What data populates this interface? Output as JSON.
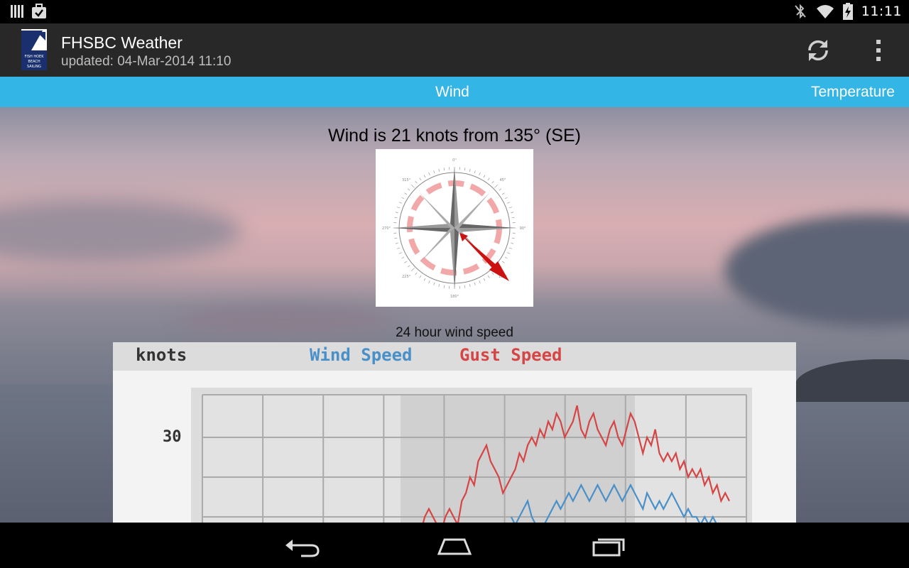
{
  "status_bar": {
    "time": "11:11",
    "left_icons": [
      "signal-bars-icon",
      "briefcase-check-icon"
    ],
    "right_icons": [
      "bluetooth-off-icon",
      "wifi-icon",
      "battery-charging-icon"
    ]
  },
  "action_bar": {
    "title": "FHSBC Weather",
    "subtitle": "updated: 04-Mar-2014 11:10",
    "logo_text": "FISH HOEK BEACH SAILING CLUB",
    "actions": [
      "refresh-icon",
      "overflow-menu-icon"
    ]
  },
  "tabs": [
    {
      "label": "Wind",
      "selected": true
    },
    {
      "label": "Temperature",
      "selected": false
    }
  ],
  "wind": {
    "headline": "Wind is 21 knots from 135° (SE)",
    "direction_deg": 135,
    "speed_knots": 21,
    "compass_labels": [
      "0°",
      "45°",
      "90°",
      "135°",
      "180°",
      "225°",
      "270°",
      "315°"
    ]
  },
  "chart": {
    "caption": "24 hour wind speed",
    "unit_label": "knots",
    "legend": [
      {
        "name": "Wind Speed",
        "color": "#4a90c8"
      },
      {
        "name": "Gust Speed",
        "color": "#d64545"
      }
    ]
  },
  "chart_data": {
    "type": "line",
    "title": "24 hour wind speed",
    "ylabel": "knots",
    "y_ticks_visible": [
      "30"
    ],
    "series": [
      {
        "name": "Wind Speed",
        "values": [
          null,
          null,
          null,
          null,
          null,
          null,
          null,
          null,
          null,
          null,
          null,
          null,
          null,
          null,
          null,
          null,
          null,
          null,
          null,
          null,
          null,
          null,
          null,
          null,
          null,
          null,
          null,
          null,
          null,
          null,
          null,
          null,
          null,
          null,
          null,
          null,
          null,
          null,
          null,
          null,
          null,
          null,
          null,
          null,
          null,
          20,
          19,
          20,
          21,
          22,
          20,
          19,
          18,
          19,
          20,
          21,
          22,
          21,
          22,
          23,
          22,
          23,
          24,
          23,
          22,
          23,
          24,
          23,
          22,
          23,
          24,
          23,
          22,
          23,
          24,
          23,
          22,
          21,
          23,
          22,
          21,
          22,
          21,
          22,
          23,
          22,
          21,
          20,
          21,
          20,
          20,
          19,
          20,
          19,
          20,
          19,
          18,
          19,
          18
        ]
      },
      {
        "name": "Gust Speed",
        "values": [
          null,
          null,
          null,
          null,
          null,
          null,
          null,
          null,
          null,
          null,
          null,
          null,
          null,
          null,
          null,
          null,
          null,
          null,
          null,
          null,
          null,
          null,
          19,
          18,
          20,
          21,
          20,
          19,
          18,
          20,
          21,
          20,
          19,
          22,
          23,
          25,
          24,
          27,
          28,
          29,
          27,
          26,
          25,
          23,
          24,
          25,
          26,
          28,
          27,
          29,
          30,
          29,
          31,
          30,
          32,
          31,
          33,
          32,
          30,
          31,
          32,
          34,
          31,
          30,
          32,
          33,
          31,
          30,
          29,
          31,
          32,
          30,
          29,
          31,
          33,
          32,
          30,
          28,
          30,
          29,
          31,
          28,
          27,
          28,
          27,
          28,
          26,
          27,
          25,
          26,
          25,
          26,
          24,
          25,
          23,
          24,
          22,
          23,
          22
        ]
      }
    ]
  },
  "nav_bar": {
    "buttons": [
      "back-icon",
      "home-icon",
      "recents-icon"
    ]
  }
}
